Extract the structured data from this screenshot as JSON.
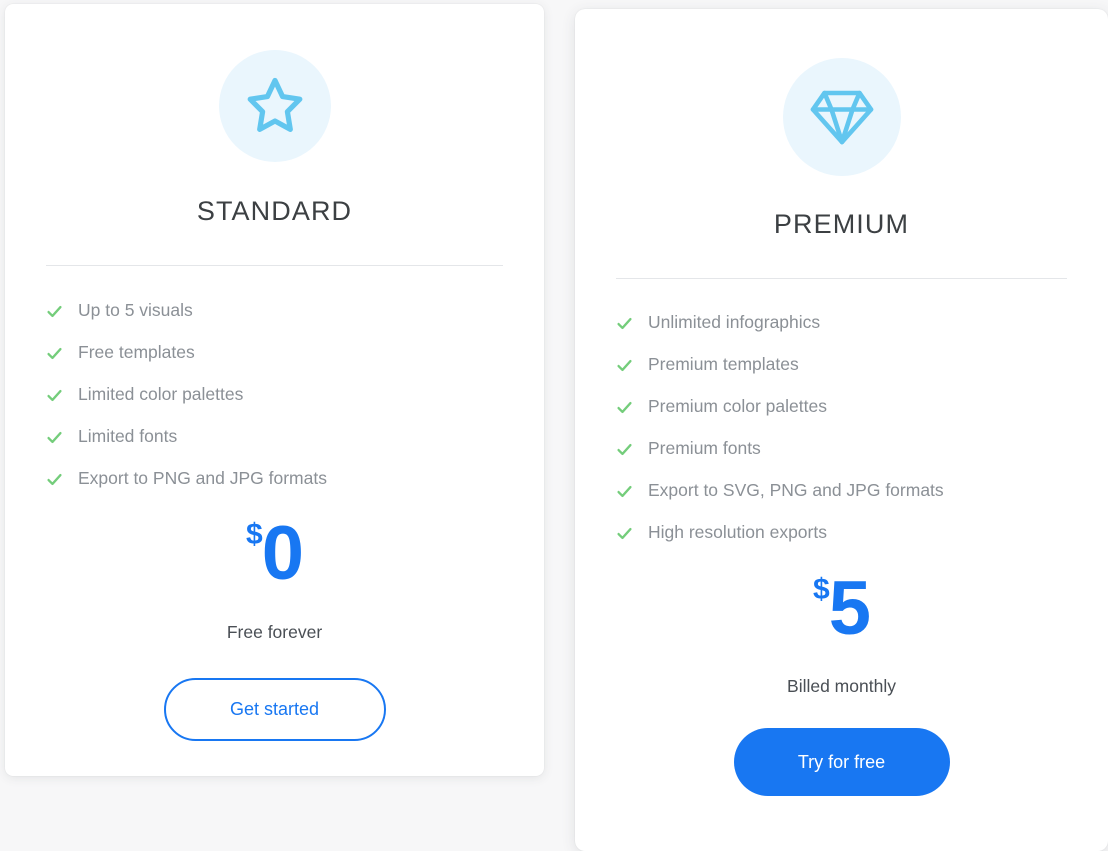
{
  "page": {
    "background_color": "#f7f7f8",
    "accent_blue": "#1877f2",
    "icon_blue": "#62c6ef",
    "icon_badge_bg": "#eaf6fd",
    "check_green": "#74cd7b",
    "feature_text_color": "#8b9096"
  },
  "plans": [
    {
      "id": "standard",
      "icon_name": "star-icon",
      "name": "STANDARD",
      "features": [
        "Up to 5 visuals",
        "Free templates",
        "Limited color palettes",
        "Limited fonts",
        "Export to PNG and JPG formats"
      ],
      "price": {
        "currency": "$",
        "amount": "0",
        "note": "Free forever"
      },
      "cta": {
        "label": "Get started",
        "style": "outline"
      }
    },
    {
      "id": "premium",
      "icon_name": "diamond-icon",
      "name": "PREMIUM",
      "features": [
        "Unlimited infographics",
        "Premium templates",
        "Premium color palettes",
        "Premium fonts",
        "Export to SVG, PNG and JPG formats",
        "High resolution exports"
      ],
      "price": {
        "currency": "$",
        "amount": "5",
        "note": "Billed monthly"
      },
      "cta": {
        "label": "Try for free",
        "style": "filled"
      }
    }
  ]
}
